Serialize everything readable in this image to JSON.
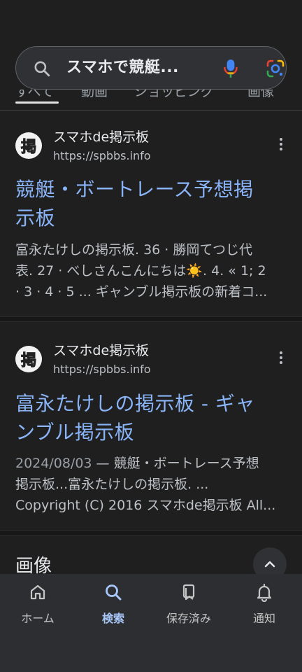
{
  "search": {
    "query": "スマホで競艇...",
    "icons": {
      "search": "search-icon",
      "voice": "mic-icon",
      "camera": "google-lens-icon"
    }
  },
  "tabs": [
    {
      "label": "すべて",
      "active": true
    },
    {
      "label": "動画",
      "active": false
    },
    {
      "label": "ショッピング",
      "active": false
    },
    {
      "label": "画像",
      "active": false
    }
  ],
  "results": [
    {
      "favicon_char": "掲",
      "site_name": "スマホde掲示板",
      "url": "https://spbbs.info",
      "title_line1": "競艇・ボートレース予想掲",
      "title_line2": "示板",
      "snippet_line1": "富永たけしの掲示板. 36 · 勝岡てつじ代",
      "snippet_line2": "表. 27 · べしさんこんにちは☀️. 4. « 1; 2",
      "snippet_line3": "· 3 · 4 · 5 ... ギャンブル掲示板の新着コ..."
    },
    {
      "favicon_char": "掲",
      "site_name": "スマホde掲示板",
      "url": "https://spbbs.info",
      "title_line1": "富永たけしの掲示板 - ギャ",
      "title_line2": "ンブル掲示板",
      "date": "2024/08/03",
      "snippet_line1_rest": " — 競艇・ボートレース予想",
      "snippet_line2": "掲示板...富永たけしの掲示板. ...",
      "snippet_line3": "Copyright (C) 2016 スマホde掲示板 All..."
    }
  ],
  "images_section": {
    "heading": "画像"
  },
  "bottom_nav": [
    {
      "label": "ホーム",
      "icon": "home-icon",
      "active": false
    },
    {
      "label": "検索",
      "icon": "search-icon",
      "active": true
    },
    {
      "label": "保存済み",
      "icon": "saved-icon",
      "active": false
    },
    {
      "label": "通知",
      "icon": "bell-icon",
      "active": false
    }
  ],
  "colors": {
    "background": "#1f1f1f",
    "link": "#8ab4f8",
    "nav_active": "#a8c7fa",
    "nav_bg": "#2d2e31"
  }
}
